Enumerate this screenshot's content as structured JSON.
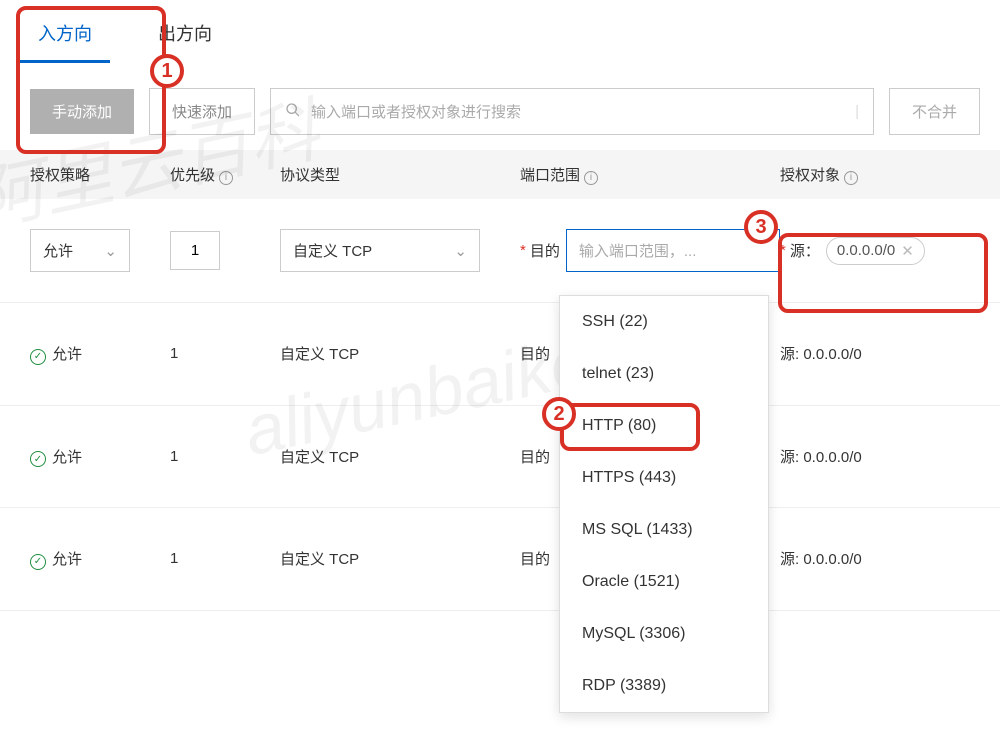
{
  "tabs": {
    "inbound": "入方向",
    "outbound": "出方向"
  },
  "toolbar": {
    "manual_add": "手动添加",
    "quick_add": "快速添加",
    "search_placeholder": "输入端口或者授权对象进行搜索",
    "merge": "不合并"
  },
  "headers": {
    "policy": "授权策略",
    "priority": "优先级",
    "protocol": "协议类型",
    "port": "端口范围",
    "target": "授权对象"
  },
  "edit_row": {
    "policy": "允许",
    "priority": "1",
    "protocol": "自定义 TCP",
    "port_label": "目的",
    "port_placeholder": "输入端口范围，...",
    "target_label": "源：",
    "target_chip": "0.0.0.0/0"
  },
  "dropdown": {
    "items": [
      "SSH (22)",
      "telnet (23)",
      "HTTP (80)",
      "HTTPS (443)",
      "MS SQL (1433)",
      "Oracle (1521)",
      "MySQL (3306)",
      "RDP (3389)"
    ]
  },
  "rows": [
    {
      "policy": "允许",
      "priority": "1",
      "protocol": "自定义 TCP",
      "port": "目的",
      "target": "源: 0.0.0.0/0"
    },
    {
      "policy": "允许",
      "priority": "1",
      "protocol": "自定义 TCP",
      "port": "目的",
      "target": "源: 0.0.0.0/0"
    },
    {
      "policy": "允许",
      "priority": "1",
      "protocol": "自定义 TCP",
      "port": "目的",
      "target": "源: 0.0.0.0/0"
    }
  ],
  "annotations": {
    "n1": "1",
    "n2": "2",
    "n3": "3"
  },
  "watermark": {
    "line1": "阿里云百科",
    "line2": "aliyunbaike.com"
  }
}
